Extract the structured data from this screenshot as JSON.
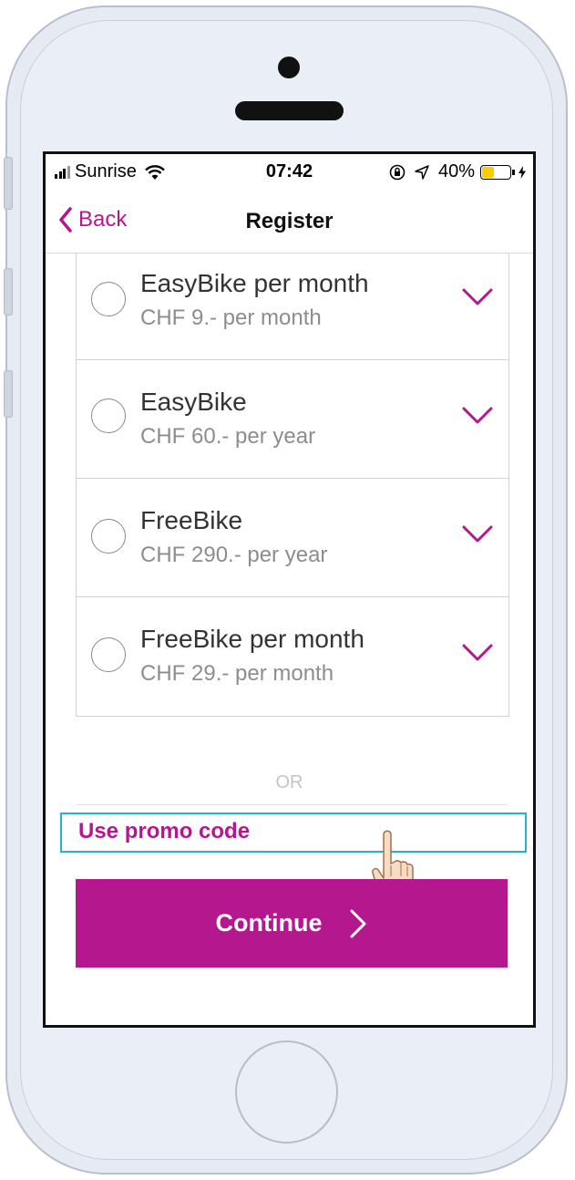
{
  "status_bar": {
    "carrier": "Sunrise",
    "time": "07:42",
    "battery_percent": "40%",
    "battery_level": 0.4,
    "battery_color": "#ffcc00"
  },
  "nav": {
    "back_label": "Back",
    "title": "Register"
  },
  "plans": [
    {
      "name": "EasyBike per month",
      "price": "CHF 9.- per month"
    },
    {
      "name": "EasyBike",
      "price": "CHF 60.- per year"
    },
    {
      "name": "FreeBike",
      "price": "CHF 290.- per year"
    },
    {
      "name": "FreeBike per month",
      "price": "CHF 29.- per month"
    }
  ],
  "or_label": "OR",
  "promo_label": "Use promo code",
  "continue_label": "Continue",
  "colors": {
    "accent": "#b5178f",
    "highlight_border": "#2ab0cd"
  },
  "icons": [
    "signal-icon",
    "wifi-icon",
    "lock-rotation-icon",
    "location-arrow-icon",
    "battery-icon",
    "charging-icon",
    "back-chevron-icon",
    "chevron-down-icon",
    "chevron-right-icon",
    "pointing-hand-icon"
  ]
}
